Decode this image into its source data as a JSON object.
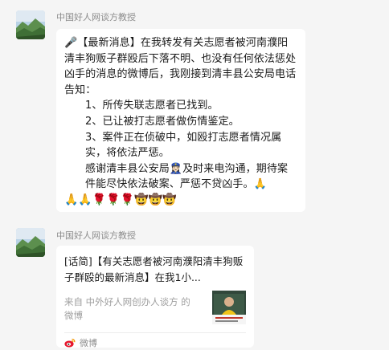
{
  "messages": [
    {
      "sender": "中国好人网谈方教授",
      "text": {
        "line1": "🎤【最新消息】在我转发有关志愿者被河南濮阳清丰狗贩子群殴后下落不明、也没有任何依法惩处凶手的消息的微博后，我刚接到清丰县公安局电话告知：",
        "item1": "1、所传失联志愿者已找到。",
        "item2": "2、已让被打志愿者做伤情鉴定。",
        "item3": "3、案件正在侦破中，如殴打志愿者情况属实，将依法严惩。",
        "thanks": "感谢清丰县公安局👮🏻‍♀️及时来电沟通，期待案件能尽快依法破案、严惩不贷凶手。🙏",
        "emojis": "🙏🙏🌹🌹🌹🤠🤠🤠"
      }
    },
    {
      "sender": "中国好人网谈方教授",
      "card": {
        "title": "[话简]【有关志愿者被河南濮阳清丰狗贩子群殴的最新消息】在我1小...",
        "source": "来自 中外好人网创办人谈方 的微博",
        "footer": "微博"
      }
    }
  ],
  "colors": {
    "background": "#f5f5f5",
    "bubble": "#ffffff",
    "sender": "#8c8c8c",
    "weibo_red": "#e6162d"
  },
  "icons": {
    "avatar": "mountain-landscape-avatar",
    "footer": "weibo-icon"
  }
}
